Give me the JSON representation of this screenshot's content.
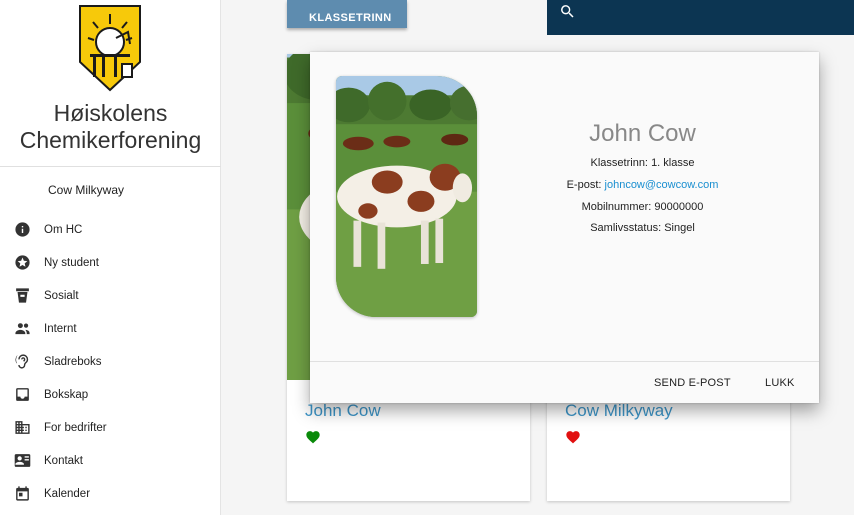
{
  "sidebar": {
    "org_name_line1": "Høiskolens",
    "org_name_line2": "Chemikerforening",
    "user": "Cow Milkyway",
    "items": [
      {
        "label": "Om HC",
        "icon": "info-icon"
      },
      {
        "label": "Ny student",
        "icon": "star-icon"
      },
      {
        "label": "Sosialt",
        "icon": "cup-icon"
      },
      {
        "label": "Internt",
        "icon": "people-icon"
      },
      {
        "label": "Sladreboks",
        "icon": "hearing-icon"
      },
      {
        "label": "Bokskap",
        "icon": "inbox-icon"
      },
      {
        "label": "For bedrifter",
        "icon": "building-icon"
      },
      {
        "label": "Kontakt",
        "icon": "contact-card-icon"
      },
      {
        "label": "Kalender",
        "icon": "calendar-icon"
      }
    ]
  },
  "toolbar": {
    "klasse_label": "KLASSETRINN",
    "search_icon": "search-icon"
  },
  "cards": [
    {
      "name": "John Cow",
      "heart_color": "#0a8a0a"
    },
    {
      "name": "Cow Milkyway",
      "heart_color": "#e11010"
    }
  ],
  "dialog": {
    "name": "John Cow",
    "klassetrinn_label": "Klassetrinn:",
    "klassetrinn_value": "1. klasse",
    "email_label": "E-post:",
    "email_value": "johncow@cowcow.com",
    "mobile_label": "Mobilnummer:",
    "mobile_value": "90000000",
    "status_label": "Samlivsstatus:",
    "status_value": "Singel",
    "send_label": "SEND E-POST",
    "close_label": "LUKK"
  },
  "colors": {
    "accent": "#5e8caf",
    "search_bar": "#0c3552",
    "link": "#3d96c9"
  }
}
